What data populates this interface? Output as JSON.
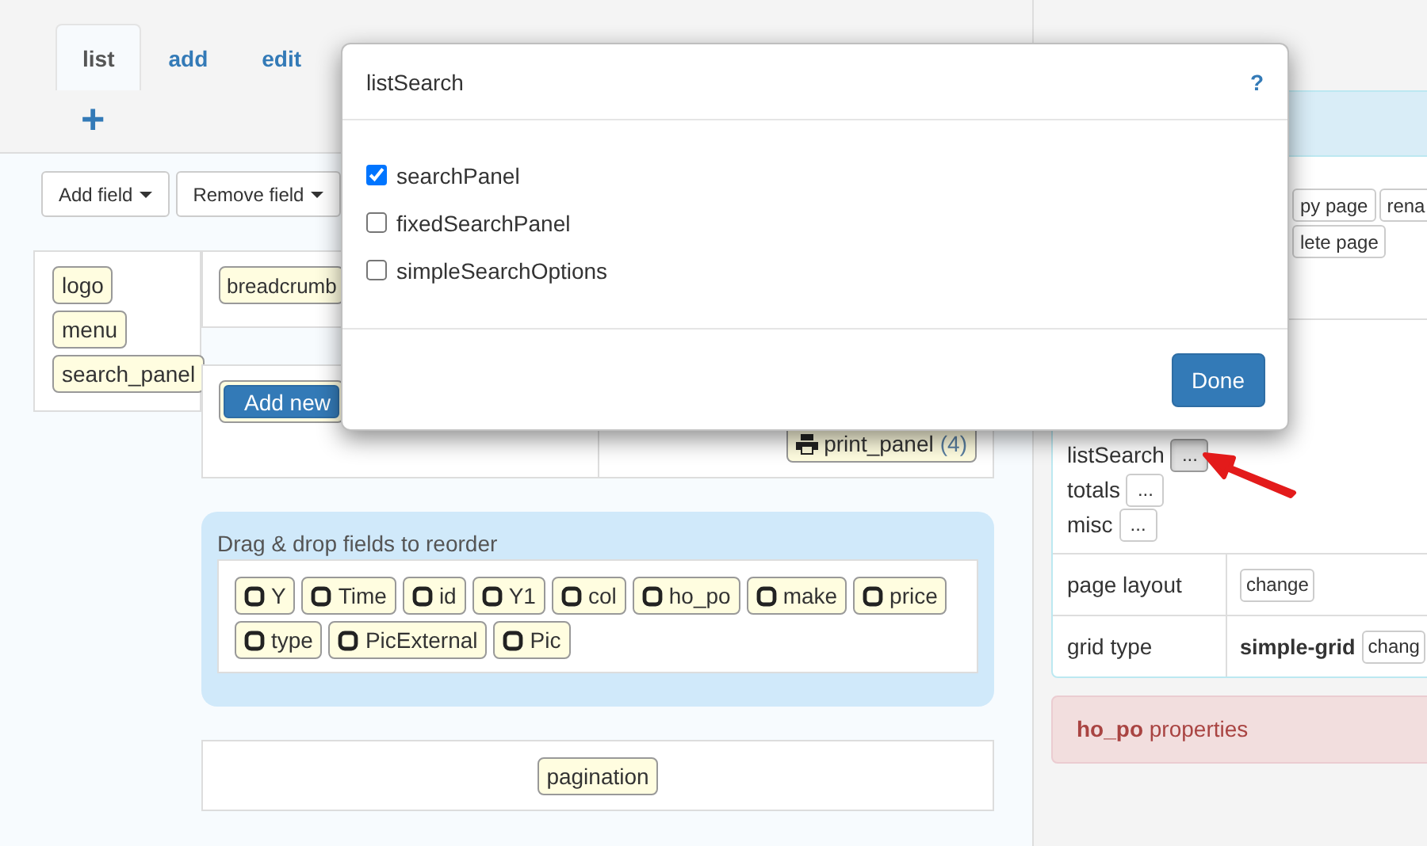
{
  "tabs": [
    {
      "label": "list",
      "selected": true
    },
    {
      "label": "add",
      "selected": false
    },
    {
      "label": "edit",
      "selected": false
    }
  ],
  "add_tab": "+",
  "toolbar": [
    {
      "label": "Add field"
    },
    {
      "label": "Remove field"
    }
  ],
  "layout": {
    "header_left": [
      "logo",
      "menu",
      "search_panel"
    ],
    "header_right": [
      "breadcrumb"
    ],
    "add_new": "Add new",
    "print_panel": {
      "label": "print_panel",
      "count": "(4)"
    }
  },
  "fields_panel": {
    "title": "Drag & drop fields to reorder",
    "fields": [
      "Y",
      "Time",
      "id",
      "Y1",
      "col",
      "ho_po",
      "make",
      "price",
      "type",
      "PicExternal",
      "Pic"
    ]
  },
  "footer_fields": [
    "pagination"
  ],
  "side": {
    "page_button_rows": [
      {
        "buttons": [
          "py page",
          "rena"
        ]
      },
      {
        "buttons": [
          "lete page"
        ]
      }
    ],
    "options": [
      {
        "label": "listSearch",
        "button": "...",
        "pressed": true
      },
      {
        "label": "totals",
        "button": "...",
        "pressed": false
      },
      {
        "label": "misc",
        "button": "...",
        "pressed": false
      }
    ],
    "rows": [
      {
        "label": "page layout",
        "button": "change"
      },
      {
        "label": "grid type",
        "value": "simple-grid",
        "button": "chang"
      }
    ],
    "alert": "**ho_po** properties"
  },
  "dialog": {
    "title": "listSearch",
    "help": "?",
    "options": [
      {
        "label": "searchPanel",
        "checked": true
      },
      {
        "label": "fixedSearchPanel",
        "checked": false
      },
      {
        "label": "simpleSearchOptions",
        "checked": false
      }
    ],
    "button": "Done"
  }
}
